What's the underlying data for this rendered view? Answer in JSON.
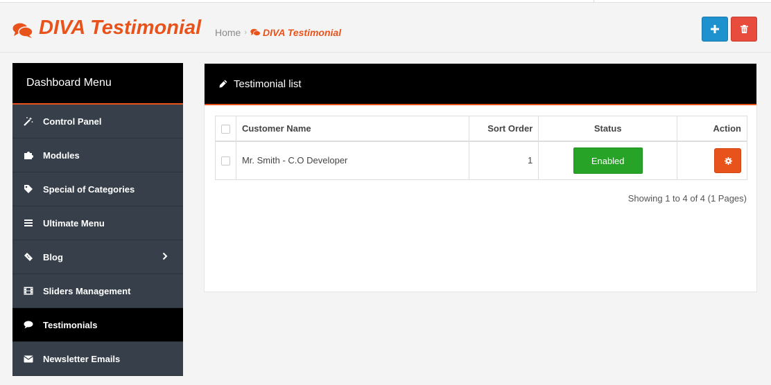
{
  "header": {
    "title": "DIVA Testimonial",
    "title_icon": "comments-icon",
    "breadcrumb": {
      "home": "Home",
      "separator": "›",
      "current": "DIVA Testimonial"
    },
    "buttons": {
      "add": "plus-icon",
      "delete": "trash-icon"
    }
  },
  "sidebar": {
    "title": "Dashboard Menu",
    "items": [
      {
        "label": "Control Panel",
        "icon": "magic-wand-icon"
      },
      {
        "label": "Modules",
        "icon": "puzzle-icon"
      },
      {
        "label": "Special of Categories",
        "icon": "tag-icon"
      },
      {
        "label": "Ultimate Menu",
        "icon": "bars-icon"
      },
      {
        "label": "Blog",
        "icon": "ticket-icon",
        "has_submenu": true
      },
      {
        "label": "Sliders Management",
        "icon": "film-icon"
      },
      {
        "label": "Testimonials",
        "icon": "comment-icon",
        "active": true
      },
      {
        "label": "Newsletter Emails",
        "icon": "envelope-icon"
      }
    ]
  },
  "panel": {
    "title": "Testimonial list",
    "title_icon": "pencil-icon",
    "table": {
      "columns": [
        "Customer Name",
        "Sort Order",
        "Status",
        "Action"
      ],
      "rows": [
        {
          "customer_name": "Mr. Smith - C.O Developer",
          "sort_order": "1",
          "status": "Enabled"
        }
      ]
    },
    "pagination_info": "Showing 1 to 4 of 4 (1 Pages)"
  },
  "colors": {
    "brand_orange": "#e8521b",
    "add_blue": "#1e91cf",
    "delete_red": "#e74c3c",
    "enabled_green": "#27a327",
    "sidebar_bg": "#37404a"
  }
}
